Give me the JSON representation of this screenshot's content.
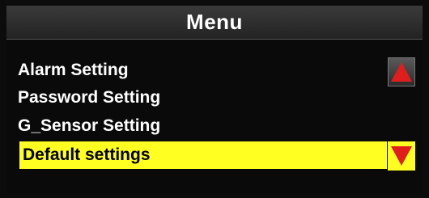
{
  "header": {
    "title": "Menu"
  },
  "menu": {
    "items": [
      {
        "label": "Alarm Setting",
        "selected": false
      },
      {
        "label": "Password Setting",
        "selected": false
      },
      {
        "label": "G_Sensor Setting",
        "selected": false
      },
      {
        "label": "Default settings",
        "selected": true
      }
    ]
  },
  "scroll": {
    "up_icon": "triangle-up-icon",
    "down_icon": "triangle-down-icon"
  },
  "colors": {
    "background": "#0c0c0c",
    "title_bar": "#2e2e2e",
    "text": "#ffffff",
    "highlight": "#ffff22",
    "highlight_text": "#000000",
    "arrow": "#e01e1e"
  }
}
